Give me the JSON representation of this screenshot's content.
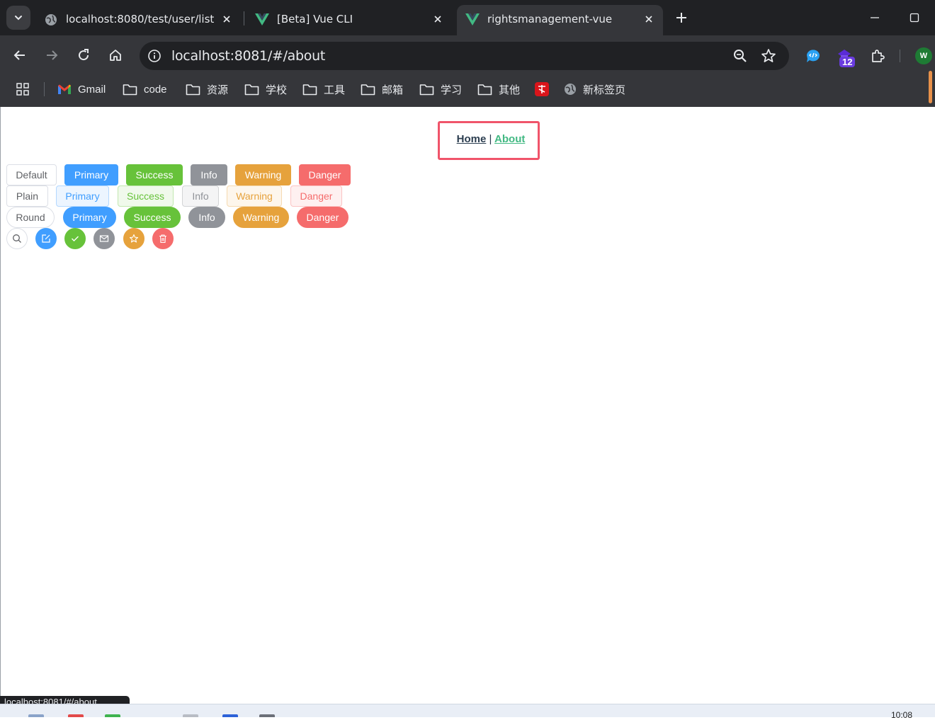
{
  "browser": {
    "tabs": [
      {
        "title": "localhost:8080/test/user/list",
        "favicon": "globe-icon",
        "active": false
      },
      {
        "title": "[Beta] Vue CLI",
        "favicon": "vue-logo-icon",
        "active": false
      },
      {
        "title": "rightsmanagement-vue",
        "favicon": "vue-logo-icon",
        "active": true
      }
    ],
    "url": "localhost:8081/#/about",
    "extension_badge": "12",
    "profile_initial": "W",
    "colors": {
      "tabstrip": "#202124",
      "toolbar": "#35363a",
      "vue_green": "#42b983"
    }
  },
  "bookmarks": [
    {
      "label": "Gmail",
      "icon": "gmail-icon"
    },
    {
      "label": "code",
      "icon": "folder-icon"
    },
    {
      "label": "资源",
      "icon": "folder-icon"
    },
    {
      "label": "学校",
      "icon": "folder-icon"
    },
    {
      "label": "工具",
      "icon": "folder-icon"
    },
    {
      "label": "邮箱",
      "icon": "folder-icon"
    },
    {
      "label": "学习",
      "icon": "folder-icon"
    },
    {
      "label": "其他",
      "icon": "folder-icon"
    },
    {
      "label": "",
      "icon": "red-app-icon"
    },
    {
      "label": "新标签页",
      "icon": "globe-icon"
    }
  ],
  "page": {
    "nav": {
      "home": "Home",
      "separator": "|",
      "about": "About"
    },
    "buttons_row_default": [
      "Default",
      "Primary",
      "Success",
      "Info",
      "Warning",
      "Danger"
    ],
    "buttons_row_plain": [
      "Plain",
      "Primary",
      "Success",
      "Info",
      "Warning",
      "Danger"
    ],
    "buttons_row_round": [
      "Round",
      "Primary",
      "Success",
      "Info",
      "Warning",
      "Danger"
    ],
    "buttons_row_circle_icons": [
      "search-icon",
      "edit-icon",
      "check-icon",
      "message-icon",
      "star-icon",
      "delete-icon"
    ],
    "colors": {
      "default": "#606266",
      "primary": "#409eff",
      "success": "#67c23a",
      "info": "#909399",
      "warning": "#e6a23c",
      "danger": "#f56c6c",
      "highlight_box": "#f0546a"
    }
  },
  "status_bar": {
    "hover_url": "localhost:8081/#/about"
  },
  "taskbar": {
    "clock": "10:08"
  }
}
